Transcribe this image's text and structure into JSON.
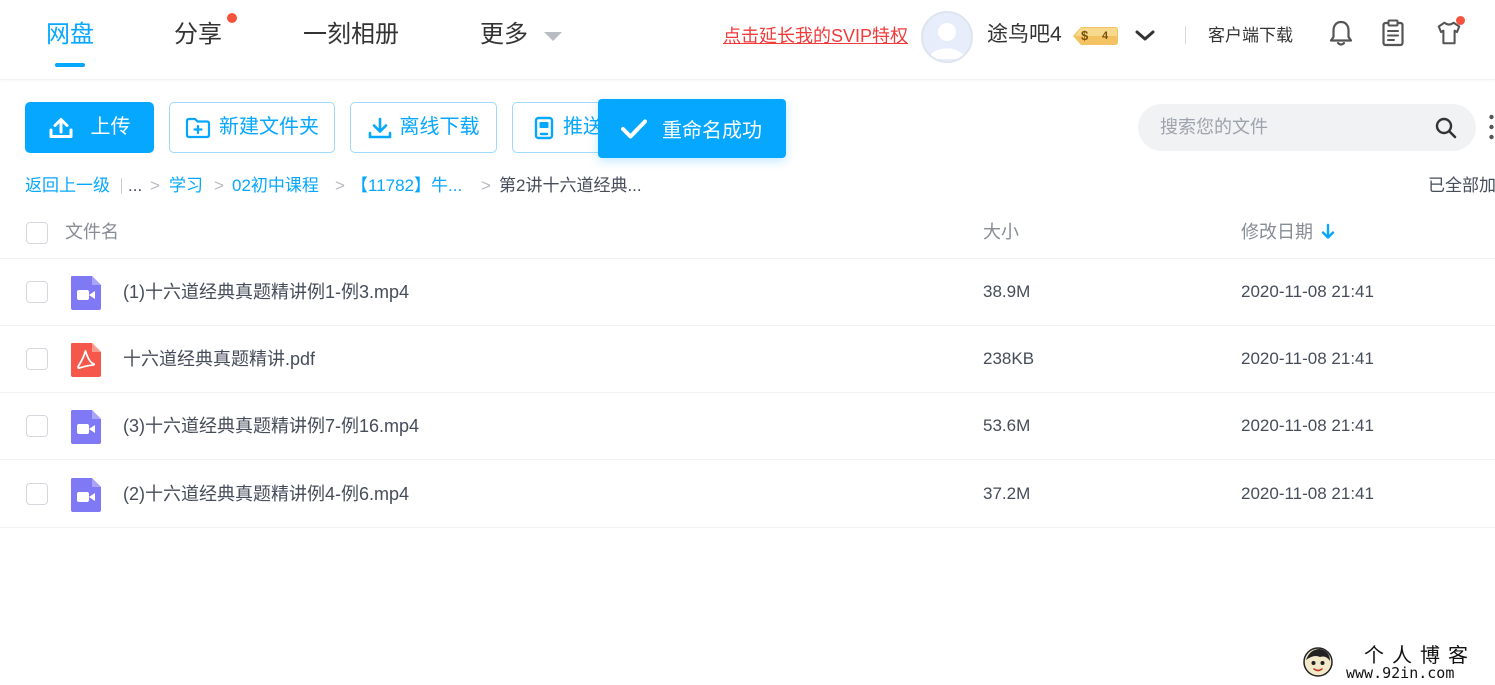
{
  "nav": {
    "tabs": [
      {
        "label": "网盘",
        "active": true
      },
      {
        "label": "分享",
        "active": false,
        "has_dot": true
      },
      {
        "label": "一刻相册",
        "active": false
      },
      {
        "label": "更多",
        "active": false,
        "has_caret": true
      }
    ],
    "svip_link": "点击延长我的SVIP特权",
    "username": "途鸟吧4",
    "vip_level": "4",
    "vip_badge_symbol": "$",
    "client_download": "客户端下载",
    "icons": [
      "bell-icon",
      "clipboard-icon",
      "tshirt-icon"
    ]
  },
  "toolbar": {
    "upload_label": "上传",
    "new_folder_label": "新建文件夹",
    "offline_download_label": "离线下载",
    "push_label": "推送",
    "search_placeholder": "搜索您的文件"
  },
  "toast": {
    "message": "重命名成功"
  },
  "breadcrumb": {
    "back_label": "返回上一级",
    "ellipsis": "...",
    "separator": ">",
    "items": [
      {
        "label": "学习",
        "link": true
      },
      {
        "label": "02初中课程",
        "link": true
      },
      {
        "label": "【11782】牛...",
        "link": true
      },
      {
        "label": "第2讲十六道经典...",
        "link": false
      }
    ],
    "status": "已全部加"
  },
  "table": {
    "columns": {
      "name": "文件名",
      "size": "大小",
      "modified": "修改日期"
    },
    "sort": {
      "column": "modified",
      "direction": "desc"
    },
    "rows": [
      {
        "name": "(1)十六道经典真题精讲例1-例3.mp4",
        "size": "38.9M",
        "modified": "2020-11-08 21:41",
        "type": "video"
      },
      {
        "name": "十六道经典真题精讲.pdf",
        "size": "238KB",
        "modified": "2020-11-08 21:41",
        "type": "pdf"
      },
      {
        "name": "(3)十六道经典真题精讲例7-例16.mp4",
        "size": "53.6M",
        "modified": "2020-11-08 21:41",
        "type": "video"
      },
      {
        "name": "(2)十六道经典真题精讲例4-例6.mp4",
        "size": "37.2M",
        "modified": "2020-11-08 21:41",
        "type": "video"
      }
    ]
  },
  "watermark": {
    "title": "个人博客",
    "url": "www.92in.com"
  },
  "colors": {
    "accent": "#06a7ff",
    "svip_red": "#f23b3b",
    "video_icon": "#8079f5",
    "pdf_icon": "#f5574a",
    "notify_dot": "#f5533d"
  }
}
